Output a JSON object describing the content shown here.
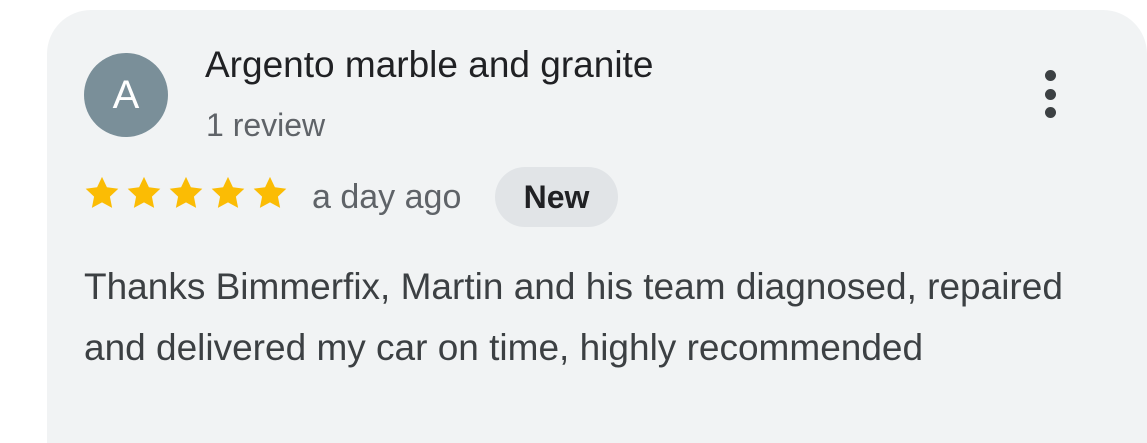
{
  "review": {
    "avatar_letter": "A",
    "avatar_color": "#7a8f99",
    "reviewer_name": "Argento marble and granite",
    "review_count": "1 review",
    "rating": 5,
    "rating_max": 5,
    "star_color": "#fbbc04",
    "time_ago": "a day ago",
    "badge": "New",
    "text": "Thanks Bimmerfix, Martin and his team diagnosed, repaired and delivered my car on time, highly recommended",
    "more_icon": "more-vert-icon"
  }
}
